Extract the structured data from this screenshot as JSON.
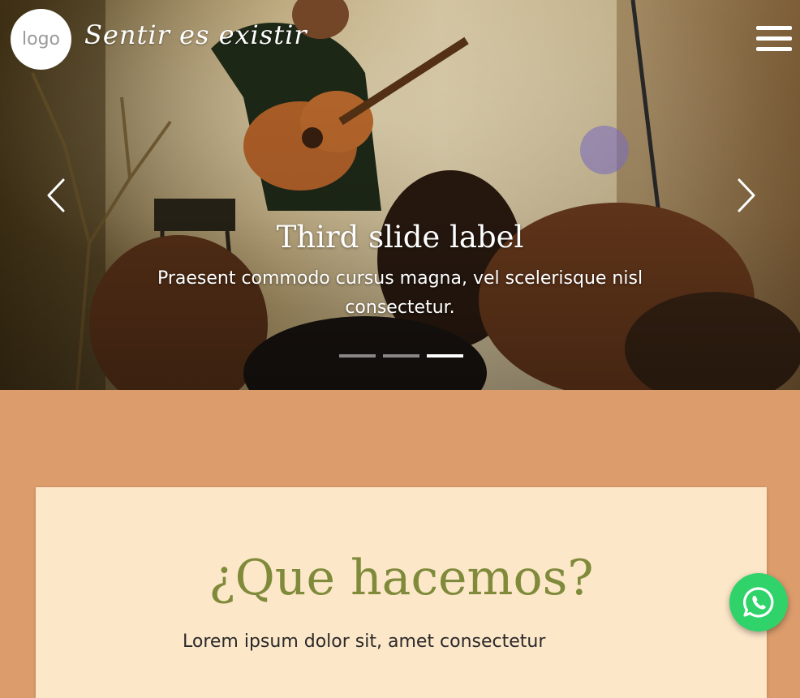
{
  "header": {
    "logo_text": "logo",
    "site_title": "Sentir es existir"
  },
  "carousel": {
    "slide_title": "Third slide label",
    "slide_text": "Praesent commodo cursus magna, vel scelerisque nisl consectetur.",
    "slide_count": 3,
    "active_slide": 3
  },
  "section": {
    "heading": "¿Que hacemos?",
    "text": "Lorem ipsum dolor sit, amet consectetur"
  },
  "colors": {
    "section_background": "#dc9c6c",
    "card_background": "#fde7c9",
    "heading_color": "#7f8a3a",
    "whatsapp_green": "#2fd36a"
  },
  "icons": {
    "prev": "chevron-left-icon",
    "next": "chevron-right-icon",
    "menu": "hamburger-menu-icon",
    "whatsapp": "whatsapp-icon"
  }
}
